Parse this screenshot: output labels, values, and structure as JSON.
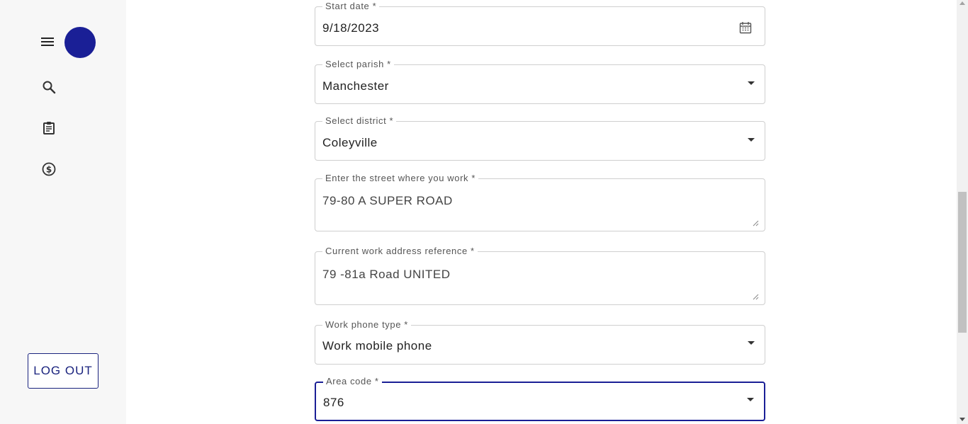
{
  "sidebar": {
    "logout_label": "LOG OUT",
    "icons": [
      "menu-icon",
      "search-icon",
      "clipboard-icon",
      "dollar-icon"
    ],
    "avatar_color": "#1a1f96"
  },
  "form": {
    "start_date": {
      "label": "Start date *",
      "value": "9/18/2023"
    },
    "parish": {
      "label": "Select parish *",
      "value": "Manchester"
    },
    "district": {
      "label": "Select district *",
      "value": "Coleyville"
    },
    "street": {
      "label": "Enter the street where you work *",
      "value": "79-80 A SUPER ROAD"
    },
    "address_ref": {
      "label": "Current work address reference *",
      "value": "79 -81a Road UNITED"
    },
    "phone_type": {
      "label": "Work phone type *",
      "value": "Work mobile phone"
    },
    "area_code": {
      "label": "Area code *",
      "value": "876"
    }
  },
  "colors": {
    "accent": "#1a1f96",
    "border": "#cfcfcf"
  }
}
